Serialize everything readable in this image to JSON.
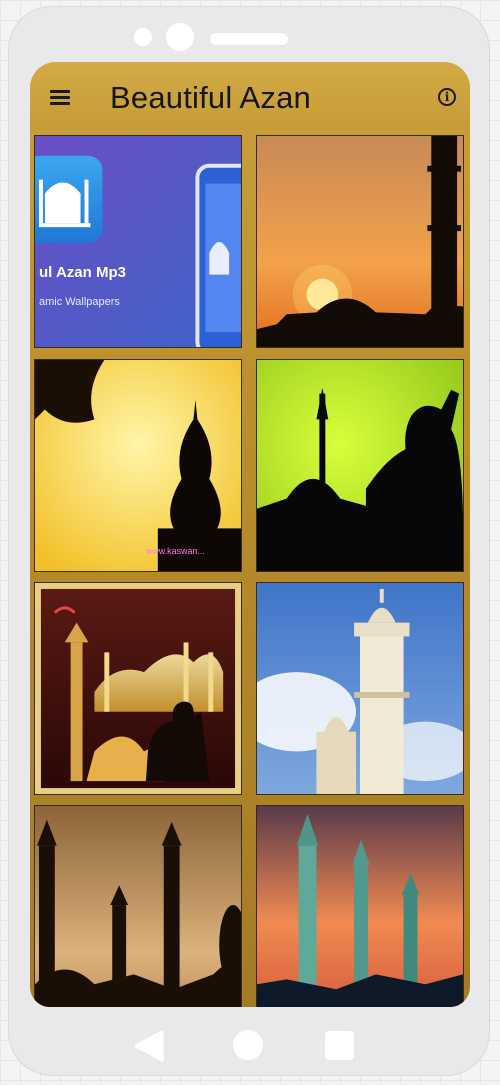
{
  "app": {
    "title": "Beautiful Azan",
    "menu_icon": "hamburger-menu-icon",
    "info_icon": "info-icon",
    "info_glyph": "i"
  },
  "promo": {
    "app_name": "ul Azan Mp3",
    "tagline": "amic Wallpapers"
  },
  "watermark": "www.kaswan...",
  "wallpapers": [
    {
      "label": "promo-banner"
    },
    {
      "label": "sunset-mosque-dome"
    },
    {
      "label": "yellow-minaret-silhouette"
    },
    {
      "label": "green-mosque-man-praying"
    },
    {
      "label": "azan-calligraphy"
    },
    {
      "label": "white-minaret-blue-sky"
    },
    {
      "label": "dusk-minarets-silhouette"
    },
    {
      "label": "lit-minarets-orange-sky"
    }
  ],
  "colors": {
    "app_bar": "#c9a13e",
    "promo_blue": "#4a5fc0"
  },
  "system_nav": {
    "back_icon": "back-triangle-icon",
    "home_icon": "home-circle-icon",
    "recents_icon": "recents-square-icon"
  }
}
